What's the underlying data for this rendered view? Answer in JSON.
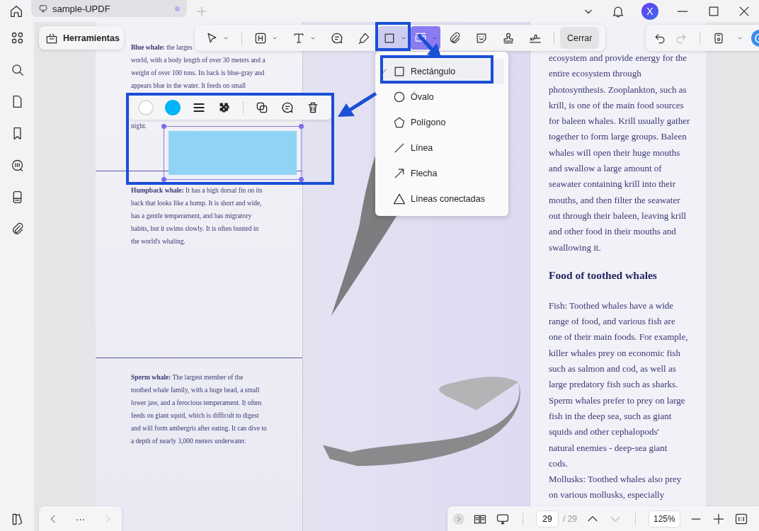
{
  "tab_bar": {
    "tabs": [
      {
        "title": "sample-UPDF",
        "selected": true,
        "modified": true
      }
    ],
    "avatar": "X"
  },
  "tools_button": {
    "label": "Herramientas"
  },
  "toolbar": {
    "tools": [
      {
        "kind": "select",
        "selected": false,
        "hovered": false,
        "caret": true
      },
      {
        "kind": "highlight",
        "selected": false,
        "hovered": false,
        "caret": true
      },
      {
        "kind": "text",
        "selected": false,
        "hovered": false,
        "caret": true
      },
      {
        "kind": "comment",
        "selected": false,
        "hovered": false,
        "caret": false
      },
      {
        "kind": "pencil",
        "selected": false,
        "hovered": false,
        "caret": false
      },
      {
        "kind": "rect",
        "selected": true,
        "hovered": false,
        "caret": true
      },
      {
        "kind": "measure",
        "selected": false,
        "hovered": true,
        "caret": true
      },
      {
        "kind": "clip",
        "selected": false,
        "hovered": false,
        "caret": false
      },
      {
        "kind": "sticker",
        "selected": false,
        "hovered": false,
        "caret": false
      },
      {
        "kind": "stamp",
        "selected": false,
        "hovered": false,
        "caret": false
      },
      {
        "kind": "signature",
        "selected": false,
        "hovered": false,
        "caret": false
      }
    ],
    "close_button": "Cerrar",
    "history": [
      {
        "kind": "undo",
        "disabled": false
      },
      {
        "kind": "redo",
        "disabled": true
      }
    ]
  },
  "shape_menu": {
    "items": [
      {
        "label": "Rectángulo",
        "kind": "rect",
        "selected": true
      },
      {
        "label": "Óvalo",
        "kind": "oval",
        "selected": false
      },
      {
        "label": "Polígono",
        "kind": "polygon",
        "selected": false
      },
      {
        "label": "Línea",
        "kind": "line",
        "selected": false
      },
      {
        "label": "Flecha",
        "kind": "arrow",
        "selected": false
      },
      {
        "label": "Líneas conectadas",
        "kind": "polyline",
        "selected": false
      }
    ]
  },
  "shape_toolbar": {
    "items": [
      {
        "kind": "stroke",
        "color": "#ffffff"
      },
      {
        "kind": "fill",
        "color": "#00b4f5"
      },
      {
        "kind": "line-width"
      },
      {
        "kind": "opacity"
      },
      {
        "kind": "duplicate"
      },
      {
        "kind": "comment"
      },
      {
        "kind": "delete"
      }
    ]
  },
  "document": {
    "left_column": [
      {
        "kind": "text",
        "lines": [
          "**Blue whale:** the larges",
          "world, with a body length of over 30 meters and a",
          "weight of over 100 tons. Its back is blue-gray and",
          "appears blue in the water. It feeds on small"
        ]
      },
      {
        "kind": "fragment",
        "lines": [
          "night."
        ]
      },
      {
        "kind": "rule"
      },
      {
        "kind": "text",
        "lines": [
          "**Humpback whale:** It has a high dorsal fin on its",
          "back that looks like a hump. It is short and wide,",
          "has a gentle temperament, and has migratory",
          "habits, but it swims slowly. It is often hunted in",
          "the world's whaling."
        ]
      },
      {
        "kind": "rule"
      },
      {
        "kind": "text",
        "lines": [
          "**Sperm whale:** The largest member of the",
          "toothed whale family, with a huge head, a small",
          "lower jaw, and a ferocious temperament. It often",
          "feeds on giant squid, which is difficult to digest",
          "and will form ambergris after eating. It can dive to",
          "a depth of nearly 3,000 meters underwater."
        ]
      }
    ],
    "right_column": [
      {
        "kind": "text",
        "lines": [
          "ecosystem and provide energy for the",
          "entire ecosystem through",
          "photosynthesis. Zooplankton, such as",
          "krill, is one of the main food sources",
          "for baleen whales. Krill usually gather",
          "together to form large groups. Baleen",
          "whales will open their huge mouths",
          "and swallow a large amount of",
          "seawater containing krill into their",
          "mouths, and then filter the seawater",
          "out through their baleen, leaving krill",
          "and other food in their mouths and",
          "swallowing it."
        ]
      },
      {
        "kind": "heading",
        "lines": [
          "Food of toothed whales"
        ]
      },
      {
        "kind": "text",
        "lines": [
          "Fish: Toothed whales have a wide",
          "range of food, and various fish are",
          "one of their main foods. For example,",
          "killer whales prey on economic fish",
          "such as salmon and cod, as well as",
          "large predatory fish such as sharks.",
          "Sperm whales prefer to prey on large",
          "fish in the deep sea, such as giant",
          "squids and other cephalopods'",
          "natural enemies - deep-sea giant",
          "cods."
        ]
      },
      {
        "kind": "text",
        "lines": [
          "Mollusks: Toothed whales also prey",
          "on various mollusks, especially"
        ]
      }
    ]
  },
  "page_nav": {
    "more": "···"
  },
  "status_bar": {
    "page": "29",
    "page_total": "/ 29",
    "zoom": "125%"
  }
}
